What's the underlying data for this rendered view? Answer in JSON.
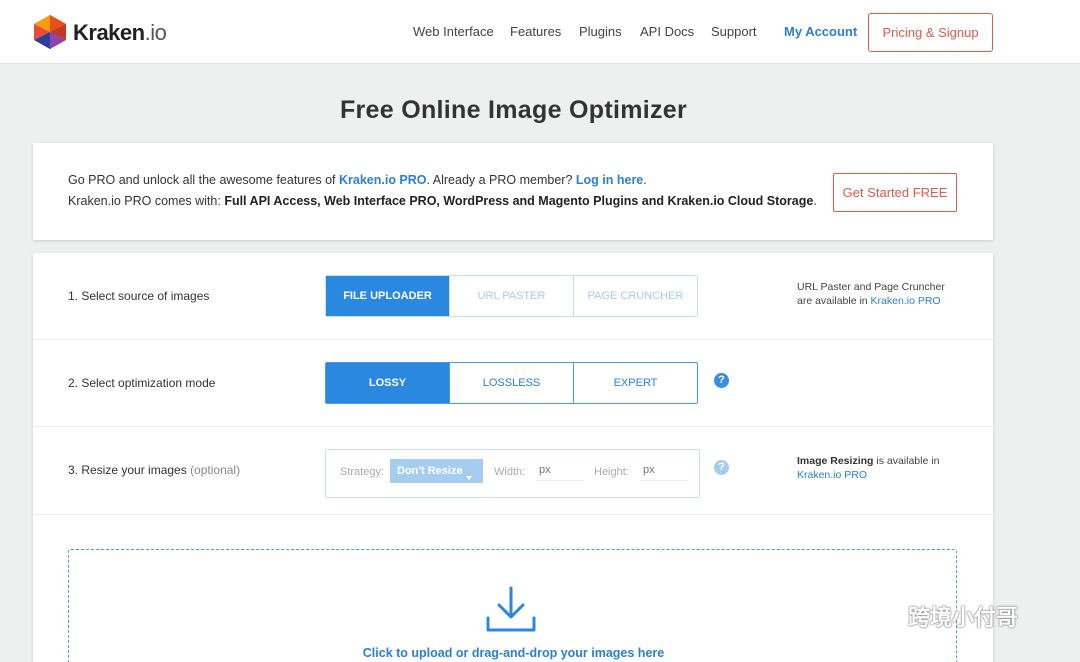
{
  "header": {
    "logo_name": "Kraken",
    "logo_suffix": ".io",
    "nav": [
      "Web Interface",
      "Features",
      "Plugins",
      "API Docs",
      "Support"
    ],
    "account": "My Account",
    "pricing": "Pricing & Signup"
  },
  "title": "Free Online Image Optimizer",
  "promo": {
    "line1_a": "Go PRO and unlock all the awesome features of ",
    "line1_link1": "Kraken.io PRO",
    "line1_b": ". Already a PRO member? ",
    "line1_link2": "Log in here",
    "line1_c": ".",
    "line2_a": "Kraken.io PRO comes with: ",
    "line2_bold": "Full API Access, Web Interface PRO, WordPress and Magento Plugins and Kraken.io Cloud Storage",
    "line2_c": ".",
    "cta": "Get Started FREE"
  },
  "steps": {
    "source": {
      "label": "1. Select source of images",
      "options": [
        "File Uploader",
        "URL Paster",
        "Page Cruncher"
      ],
      "note_a": "URL Paster and Page Cruncher",
      "note_b": "are available in ",
      "note_link": "Kraken.io PRO"
    },
    "mode": {
      "label": "2. Select optimization mode",
      "options": [
        "Lossy",
        "Lossless",
        "Expert"
      ],
      "help": "?"
    },
    "resize": {
      "label": "3. Resize your images",
      "label_opt": "(optional)",
      "strategy_label": "Strategy:",
      "strategy_value": "Don't Resize",
      "width_label": "Width:",
      "height_label": "Height:",
      "px": "px",
      "help": "?",
      "note_bold": "Image Resizing",
      "note_a": " is available in",
      "note_link": "Kraken.io PRO"
    }
  },
  "dropzone": {
    "text": "Click to upload or drag-and-drop your images here"
  },
  "watermark": "跨境小付哥",
  "colors": {
    "accent": "#2b88e0",
    "cta": "#e05a4f",
    "background": "#eef0f0"
  }
}
